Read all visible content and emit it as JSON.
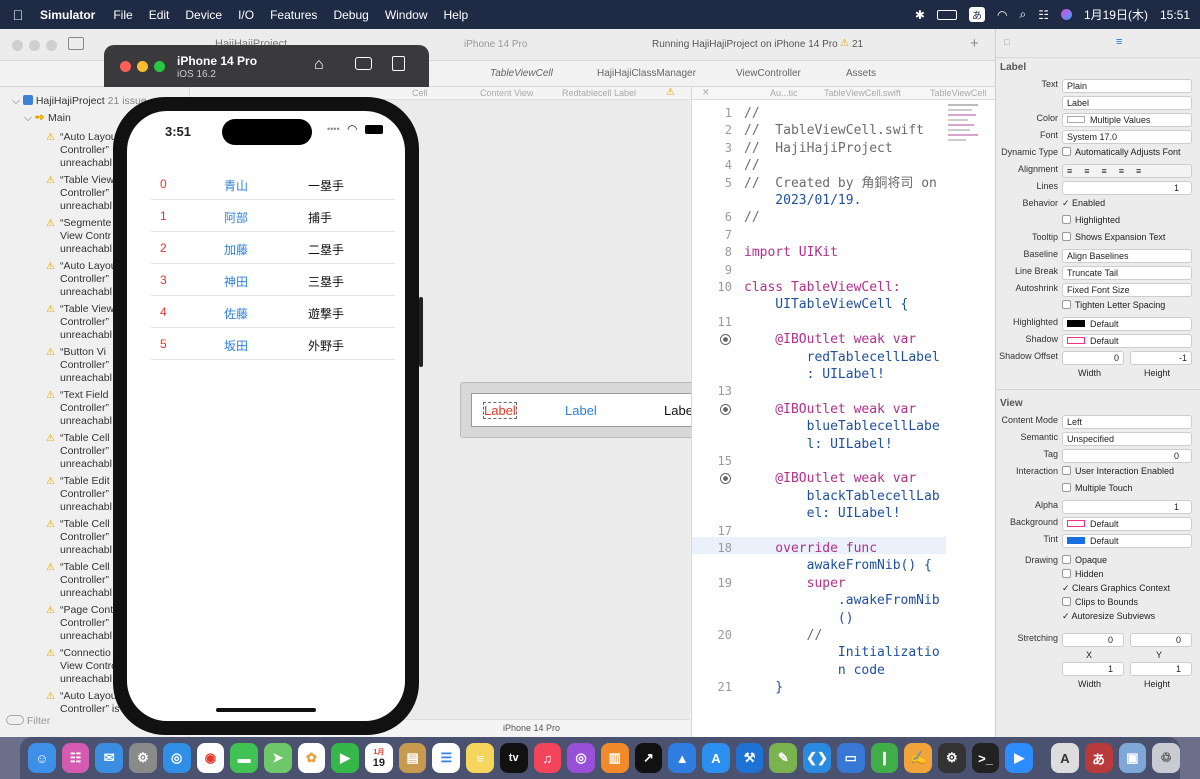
{
  "menubar": {
    "app": "Simulator",
    "items": [
      "File",
      "Edit",
      "Device",
      "I/O",
      "Features",
      "Debug",
      "Window",
      "Help"
    ],
    "ime": "あ",
    "date": "1月19日(木)",
    "time": "15:51"
  },
  "xcode": {
    "project_title": "HajiHajiProject",
    "run_status": "Running HajiHajiProject on iPhone 14 Pro",
    "warning_count": "21",
    "device_target": "iPhone 14 Pro",
    "tabs": [
      "TableViewCell",
      "HajiHajiClassManager",
      "ViewController",
      "Assets"
    ],
    "breadcrumb_left": [
      "Cell",
      "Content View",
      "Redtablecell Label"
    ],
    "breadcrumb_right": [
      "Au...tic",
      "TableViewCell.swift",
      "TableViewCell"
    ],
    "navigator": {
      "root": "HajiHajiProject",
      "root_issues": "21 issue",
      "group": "Main",
      "issues": [
        [
          "“Auto Layou",
          "Controller”",
          "unreachabl"
        ],
        [
          "“Table View",
          "Controller”",
          "unreachabl"
        ],
        [
          "“Segmente",
          "View Contr",
          "unreachabl"
        ],
        [
          "“Auto Layou",
          "Controller”",
          "unreachabl"
        ],
        [
          "“Table View",
          "Controller”",
          "unreachabl"
        ],
        [
          "“Button Vi",
          "Controller”",
          "unreachabl"
        ],
        [
          "“Text Field",
          "Controller”",
          "unreachabl"
        ],
        [
          "“Table Cell",
          "Controller”",
          "unreachabl"
        ],
        [
          "“Table Edit",
          "Controller”",
          "unreachabl"
        ],
        [
          "“Table Cell",
          "Controller”",
          "unreachabl"
        ],
        [
          "“Table Cell",
          "Controller”",
          "unreachabl"
        ],
        [
          "“Page Cont",
          "Controller”",
          "unreachabl"
        ],
        [
          "“Connectio",
          "View Contro",
          "unreachabl"
        ],
        [
          "“Auto Layou",
          "Controller” is"
        ]
      ],
      "filter_placeholder": "Filter"
    },
    "canvas": {
      "cell_labels": [
        "Label",
        "Label",
        "Label"
      ],
      "bottom_device": "iPhone 14 Pro",
      "bottom_project": "HajiHajiProject"
    },
    "code_lines": [
      {
        "n": "1",
        "t": "//"
      },
      {
        "n": "2",
        "t": "//  TableViewCell.swift"
      },
      {
        "n": "3",
        "t": "//  HajiHajiProject"
      },
      {
        "n": "4",
        "t": "//"
      },
      {
        "n": "5",
        "t": "//  Created by 角銅将司 on"
      },
      {
        "n": "",
        "t": "    2023/01/19."
      },
      {
        "n": "6",
        "t": "//"
      },
      {
        "n": "7",
        "t": ""
      },
      {
        "n": "8",
        "t": "import UIKit"
      },
      {
        "n": "9",
        "t": ""
      },
      {
        "n": "10",
        "t": "class TableViewCell:"
      },
      {
        "n": "",
        "t": "    UITableViewCell {"
      },
      {
        "n": "11",
        "t": ""
      },
      {
        "n": "",
        "t": "    @IBOutlet weak var"
      },
      {
        "n": "",
        "t": "        redTablecellLabel"
      },
      {
        "n": "",
        "t": "        : UILabel!"
      },
      {
        "n": "13",
        "t": ""
      },
      {
        "n": "",
        "t": "    @IBOutlet weak var"
      },
      {
        "n": "",
        "t": "        blueTablecellLabe"
      },
      {
        "n": "",
        "t": "        l: UILabel!"
      },
      {
        "n": "15",
        "t": ""
      },
      {
        "n": "",
        "t": "    @IBOutlet weak var"
      },
      {
        "n": "",
        "t": "        blackTablecellLab"
      },
      {
        "n": "",
        "t": "        el: UILabel!"
      },
      {
        "n": "17",
        "t": ""
      },
      {
        "n": "18",
        "t": "    override func"
      },
      {
        "n": "",
        "t": "        awakeFromNib() {"
      },
      {
        "n": "19",
        "t": "        super"
      },
      {
        "n": "",
        "t": "            .awakeFromNib"
      },
      {
        "n": "",
        "t": "            ()"
      },
      {
        "n": "20",
        "t": "        //"
      },
      {
        "n": "",
        "t": "            Initializatio"
      },
      {
        "n": "",
        "t": "            n code"
      },
      {
        "n": "21",
        "t": "    }"
      }
    ]
  },
  "inspector": {
    "label_section": "Label",
    "text_type": "Plain",
    "text_value": "Label",
    "color": "Multiple Values",
    "font": "System 17.0",
    "dynamic_type": "Automatically Adjusts Font",
    "lines": "1",
    "behavior_enabled": "Enabled",
    "behavior_highlighted": "Highlighted",
    "tooltip": "Shows Expansion Text",
    "baseline": "Align Baselines",
    "line_break": "Truncate Tail",
    "autoshrink": "Fixed Font Size",
    "tighten": "Tighten Letter Spacing",
    "highlighted": "Default",
    "shadow": "Default",
    "shadow_offset_w": "0",
    "shadow_offset_h": "-1",
    "width_label": "Width",
    "height_label": "Height",
    "view_section": "View",
    "content_mode": "Left",
    "semantic": "Unspecified",
    "tag": "0",
    "interaction_1": "User Interaction Enabled",
    "interaction_2": "Multiple Touch",
    "alpha": "1",
    "background": "Default",
    "tint": "Default",
    "drawing": [
      "Opaque",
      "Hidden",
      "Clears Graphics Context",
      "Clips to Bounds",
      "Autoresize Subviews"
    ],
    "stretching_x": "0",
    "stretching_y": "0",
    "stretching_w": "1",
    "stretching_h": "1",
    "x_label": "X",
    "y_label": "Y",
    "labels": {
      "text": "Text",
      "color": "Color",
      "font": "Font",
      "dynamic": "Dynamic Type",
      "alignment": "Alignment",
      "lines": "Lines",
      "behavior": "Behavior",
      "tooltip": "Tooltip",
      "baseline": "Baseline",
      "linebreak": "Line Break",
      "autoshrink": "Autoshrink",
      "highlighted": "Highlighted",
      "shadow": "Shadow",
      "shadowoffset": "Shadow Offset",
      "contentmode": "Content Mode",
      "semantic": "Semantic",
      "tag": "Tag",
      "interaction": "Interaction",
      "alpha": "Alpha",
      "background": "Background",
      "tint": "Tint",
      "drawing": "Drawing",
      "stretching": "Stretching"
    }
  },
  "simulator": {
    "device": "iPhone 14 Pro",
    "os": "iOS 16.2",
    "status_time": "3:51",
    "rows": [
      {
        "num": "0",
        "name": "青山",
        "pos": "一塁手"
      },
      {
        "num": "1",
        "name": "阿部",
        "pos": "捕手"
      },
      {
        "num": "2",
        "name": "加藤",
        "pos": "二塁手"
      },
      {
        "num": "3",
        "name": "神田",
        "pos": "三塁手"
      },
      {
        "num": "4",
        "name": "佐藤",
        "pos": "遊撃手"
      },
      {
        "num": "5",
        "name": "坂田",
        "pos": "外野手"
      }
    ]
  },
  "dock": {
    "calendar_month": "1月",
    "calendar_day": "19",
    "tv": "tv"
  },
  "colors": {
    "red": "#e0382b",
    "blue": "#2f80d8",
    "accent": "#1a6fe0"
  }
}
